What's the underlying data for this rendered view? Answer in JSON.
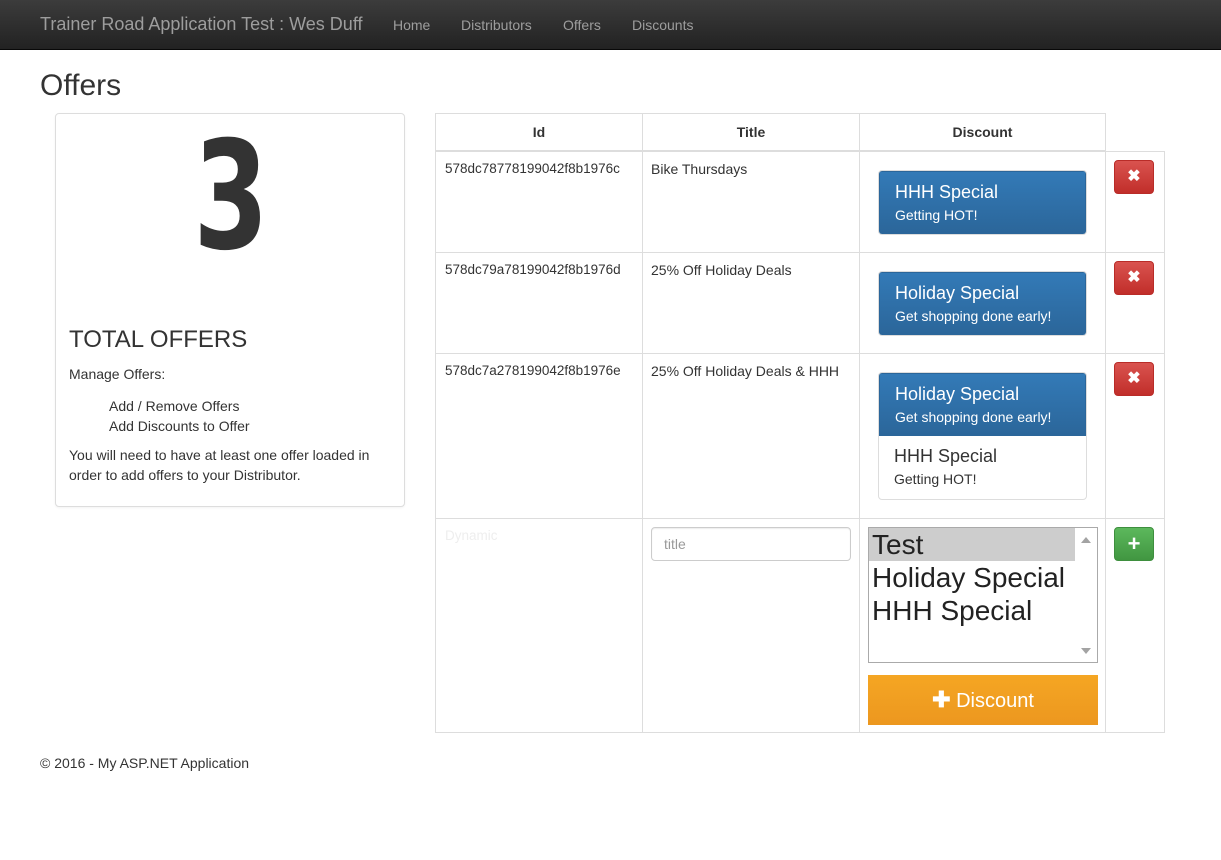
{
  "navbar": {
    "brand": "Trainer Road Application Test : Wes Duff",
    "links": [
      "Home",
      "Distributors",
      "Offers",
      "Discounts"
    ]
  },
  "page": {
    "title": "Offers"
  },
  "summary": {
    "count": "3",
    "label": "TOTAL OFFERS",
    "manage_label": "Manage Offers:",
    "manage_items": [
      "Add / Remove Offers",
      "Add Discounts to Offer"
    ],
    "note": "You will need to have at least one offer loaded in order to add offers to your Distributor."
  },
  "table": {
    "headers": {
      "id": "Id",
      "title": "Title",
      "discount": "Discount"
    },
    "rows": [
      {
        "id": "578dc78778199042f8b1976c",
        "title": "Bike Thursdays",
        "discounts": [
          {
            "name": "HHH Special",
            "desc": "Getting HOT!",
            "active": true
          }
        ]
      },
      {
        "id": "578dc79a78199042f8b1976d",
        "title": "25% Off Holiday Deals",
        "discounts": [
          {
            "name": "Holiday Special",
            "desc": "Get shopping done early!",
            "active": true
          }
        ]
      },
      {
        "id": "578dc7a278199042f8b1976e",
        "title": "25% Off Holiday Deals & HHH",
        "discounts": [
          {
            "name": "Holiday Special",
            "desc": "Get shopping done early!",
            "active": true
          },
          {
            "name": "HHH Special",
            "desc": "Getting HOT!",
            "active": false
          }
        ]
      }
    ],
    "new_row": {
      "id_placeholder": "Dynamic",
      "title_placeholder": "title",
      "discount_options": [
        "Test",
        "Holiday Special",
        "HHH Special"
      ],
      "selected_option": "Test",
      "add_discount_label": "Discount"
    },
    "icons": {
      "delete": "remove-icon",
      "add": "plus-icon"
    }
  },
  "footer": {
    "text": "© 2016 - My ASP.NET Application"
  },
  "colors": {
    "navbar": "#222222",
    "primary": "#337ab7",
    "danger": "#d9534f",
    "success": "#5cb85c",
    "warning": "#f0ad4e"
  }
}
